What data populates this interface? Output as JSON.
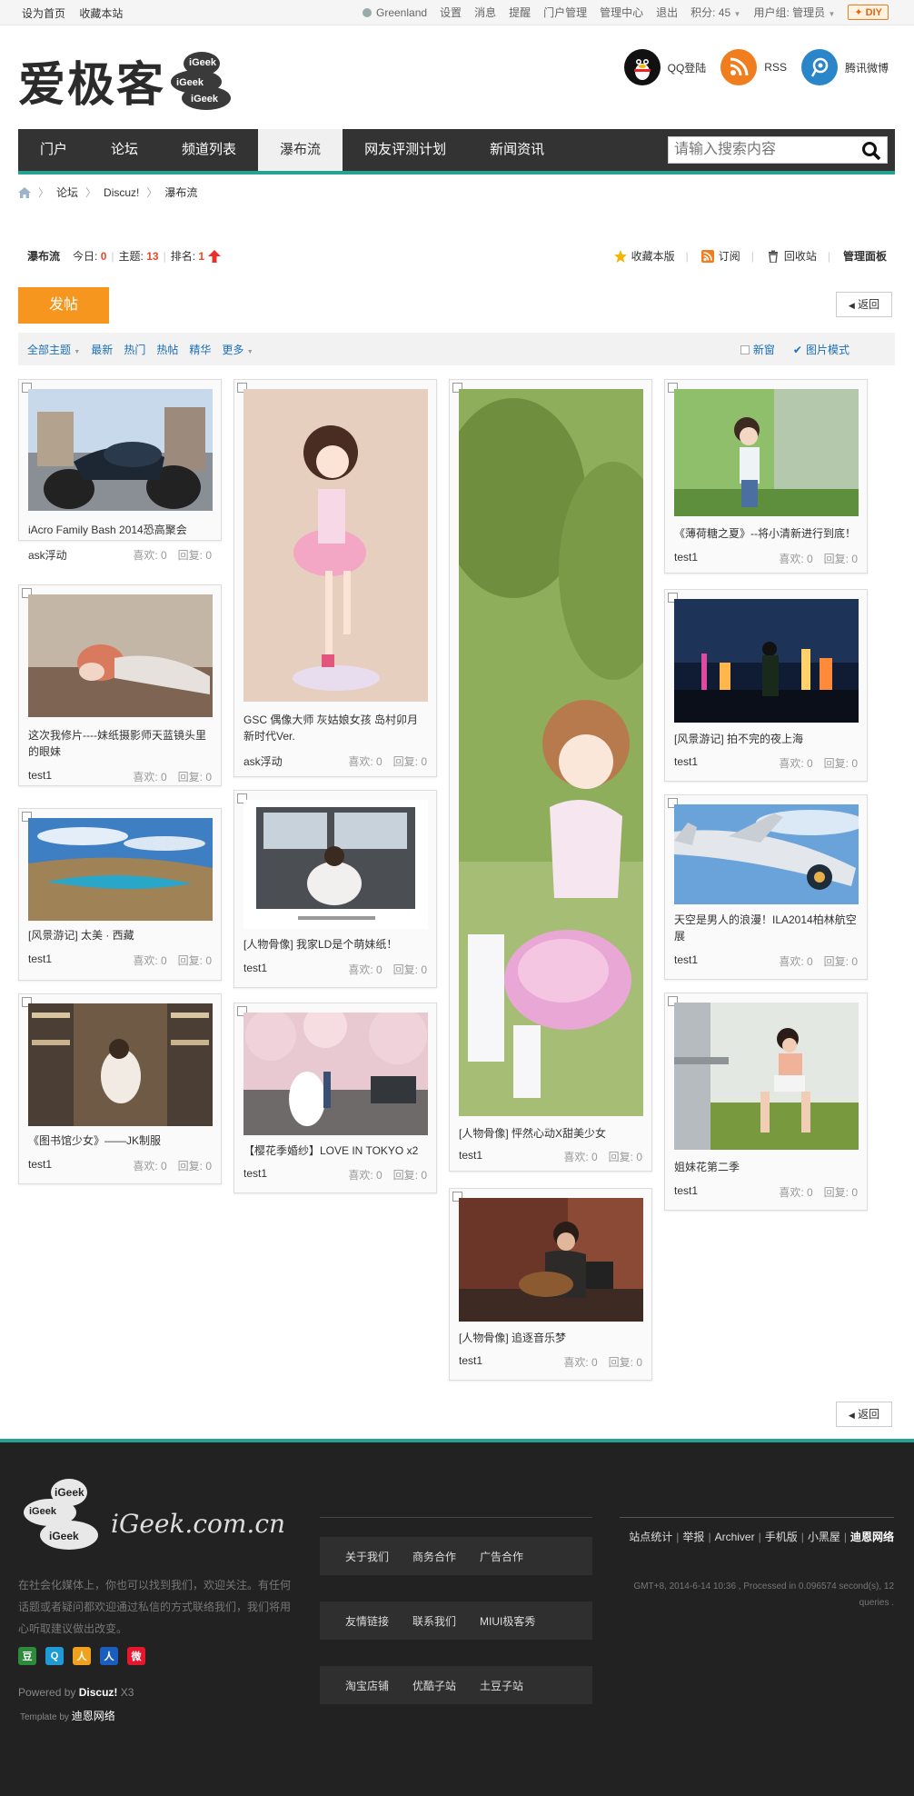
{
  "topbar": {
    "set_home": "设为首页",
    "bookmark": "收藏本站",
    "username": "Greenland",
    "links": [
      "设置",
      "消息",
      "提醒",
      "门户管理",
      "管理中心",
      "退出"
    ],
    "points": "积分: 45",
    "usergroup": "用户组: 管理员",
    "diy": "DIY"
  },
  "header": {
    "logo_text": "爱极客",
    "logo_cloud_words": [
      "iGeek",
      "iGeek",
      "iGeek"
    ],
    "qq_login": "QQ登陆",
    "rss": "RSS",
    "weibo": "腾讯微博"
  },
  "nav": {
    "items": [
      "门户",
      "论坛",
      "频道列表",
      "瀑布流",
      "网友评测计划",
      "新闻资讯"
    ],
    "search_placeholder": "请输入搜索内容"
  },
  "breadcrumb": [
    "论坛",
    "Discuz!",
    "瀑布流"
  ],
  "forum": {
    "name": "瀑布流",
    "today_label": "今日:",
    "today": "0",
    "topics_label": "主题:",
    "topics": "13",
    "rank_label": "排名:",
    "rank": "1",
    "tools": [
      "收藏本版",
      "订阅",
      "回收站",
      "管理面板"
    ]
  },
  "post_button": "发帖",
  "back_button": "返回",
  "filter": {
    "tabs": [
      "全部主题",
      "最新",
      "热门",
      "热帖",
      "精华",
      "更多"
    ],
    "new_window": "新窗",
    "image_mode": "图片模式"
  },
  "cards": [
    {
      "title": "iAcro Family Bash 2014恐高聚会",
      "author": "ask浮动",
      "likes": "喜欢: 0",
      "replies": "回复: 0"
    },
    {
      "title": "这次我修片----妹纸摄影师天蓝镜头里的眼妹",
      "author": "test1",
      "likes": "喜欢: 0",
      "replies": "回复: 0"
    },
    {
      "title": "[风景游记] 太美 · 西藏",
      "author": "test1",
      "likes": "喜欢: 0",
      "replies": "回复: 0"
    },
    {
      "title": "《图书馆少女》——JK制服",
      "author": "test1",
      "likes": "喜欢: 0",
      "replies": "回复: 0"
    },
    {
      "title": "GSC 偶像大师 灰姑娘女孩 岛村卯月 新时代Ver.",
      "author": "ask浮动",
      "likes": "喜欢: 0",
      "replies": "回复: 0"
    },
    {
      "title": "[人物骨像] 我家LD是个萌妹纸！",
      "author": "test1",
      "likes": "喜欢: 0",
      "replies": "回复: 0"
    },
    {
      "title": "【樱花季婚纱】LOVE IN TOKYO x2",
      "author": "test1",
      "likes": "喜欢: 0",
      "replies": "回复: 0"
    },
    {
      "title": "[人物骨像] 怦然心动X甜美少女",
      "author": "test1",
      "likes": "喜欢: 0",
      "replies": "回复: 0"
    },
    {
      "title": "[人物骨像] 追逐音乐梦",
      "author": "test1",
      "likes": "喜欢: 0",
      "replies": "回复: 0"
    },
    {
      "title": "《薄荷糖之夏》--将小清新进行到底！",
      "author": "test1",
      "likes": "喜欢: 0",
      "replies": "回复: 0"
    },
    {
      "title": "[风景游记] 拍不完的夜上海",
      "author": "test1",
      "likes": "喜欢: 0",
      "replies": "回复: 0"
    },
    {
      "title": "天空是男人的浪漫！ILA2014柏林航空展",
      "author": "test1",
      "likes": "喜欢: 0",
      "replies": "回复: 0"
    },
    {
      "title": "姐妹花第二季",
      "author": "test1",
      "likes": "喜欢: 0",
      "replies": "回复: 0"
    }
  ],
  "footer": {
    "site": "iGeek.com.cn",
    "cloud_words": [
      "iGeek",
      "iGeek",
      "iGeek"
    ],
    "description": "在社会化媒体上，你也可以找到我们，欢迎关注。有任何话题或者疑问都欢迎通过私信的方式联络我们，我们将用心听取建议做出改变。",
    "share_icons": [
      "豆",
      "Q",
      "人",
      "人",
      "微"
    ],
    "powered_prefix": "Powered by",
    "powered_name": "Discuz!",
    "powered_version": "X3",
    "template_prefix": "Template by",
    "template_name": "迪恩网络",
    "link_rows": [
      [
        "关于我们",
        "商务合作",
        "广告合作"
      ],
      [
        "友情链接",
        "联系我们",
        "MIUI极客秀"
      ],
      [
        "淘宝店铺",
        "优酷子站",
        "土豆子站"
      ]
    ],
    "right_links": [
      "站点统计",
      "举报",
      "Archiver",
      "手机版",
      "小黑屋"
    ],
    "right_brand": "迪恩网络",
    "gmt": "GMT+8, 2014-6-14 10:36 , Processed in 0.096574 second(s), 12 queries ."
  },
  "colors": {
    "accent": "#24a393",
    "nav_bg": "#333333",
    "post_button": "#f7961e",
    "link_blue": "#1c6fb8",
    "count_red": "#e84a2a",
    "footer_bg": "#222222"
  }
}
